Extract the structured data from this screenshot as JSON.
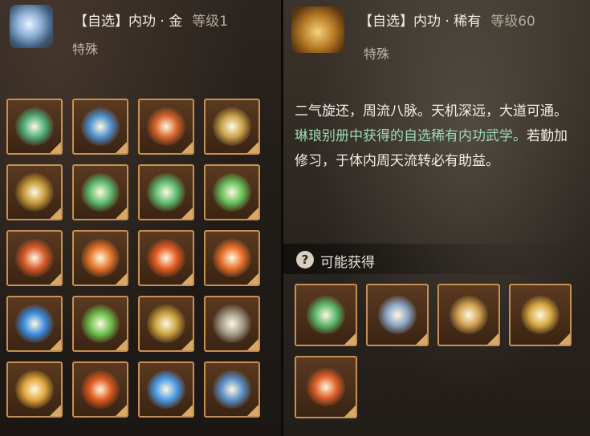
{
  "left": {
    "title": "【自选】内功 · 金",
    "level": "等级1",
    "subtitle": "特殊",
    "header_icon": "silver-cube-icon",
    "skills": [
      {
        "icon": "green-swirl-icon",
        "color": "#4fae7a"
      },
      {
        "icon": "blue-swirl-icon",
        "color": "#4e8fcf"
      },
      {
        "icon": "red-core-icon",
        "color": "#d8642c"
      },
      {
        "icon": "golden-sun-icon",
        "color": "#c9a24a"
      },
      {
        "icon": "golden-eagle-icon",
        "color": "#c49a3a"
      },
      {
        "icon": "green-sword-icon",
        "color": "#5dbb6f"
      },
      {
        "icon": "green-crane-icon",
        "color": "#5dbb6f"
      },
      {
        "icon": "green-blade-icon",
        "color": "#66c05a"
      },
      {
        "icon": "red-ring-icon",
        "color": "#d85a2a"
      },
      {
        "icon": "crossed-swords-icon",
        "color": "#e7752c"
      },
      {
        "icon": "fire-icon",
        "color": "#e55b22"
      },
      {
        "icon": "fire-slash-icon",
        "color": "#e8702a"
      },
      {
        "icon": "blue-orb-icon",
        "color": "#3a8be0"
      },
      {
        "icon": "green-vortex-icon",
        "color": "#6cbf4b"
      },
      {
        "icon": "golden-dragon-icon",
        "color": "#c9a040"
      },
      {
        "icon": "silver-rock-icon",
        "color": "#a39a8a"
      },
      {
        "icon": "golden-flash-icon",
        "color": "#e0a63a"
      },
      {
        "icon": "fire-ring-icon",
        "color": "#e0581f"
      },
      {
        "icon": "blue-crystal-icon",
        "color": "#4a9be8"
      },
      {
        "icon": "blue-hourglass-icon",
        "color": "#5a90c8"
      }
    ]
  },
  "right": {
    "title": "【自选】内功 · 稀有",
    "level": "等级60",
    "subtitle": "特殊",
    "header_icon": "treasure-chest-icon",
    "desc_white": "二气旋还，周流八脉。天机深远，大道可通。",
    "desc_green": "琳琅别册中获得的自选稀有内功武学。",
    "desc_white2": "若勤加修习，于体内周天流转必有助益。",
    "obtain_label": "可能获得",
    "obtain_icon": "question-icon",
    "obtain_icon_glyph": "?",
    "rewards": [
      {
        "icon": "green-spirit-icon",
        "color": "#5ab86a"
      },
      {
        "icon": "silver-beast-icon",
        "color": "#8aa4c4"
      },
      {
        "icon": "golden-orb-icon",
        "color": "#d0a050"
      },
      {
        "icon": "golden-blades-icon",
        "color": "#d4a842"
      },
      {
        "icon": "fire-orb-icon",
        "color": "#e0602a"
      }
    ]
  }
}
